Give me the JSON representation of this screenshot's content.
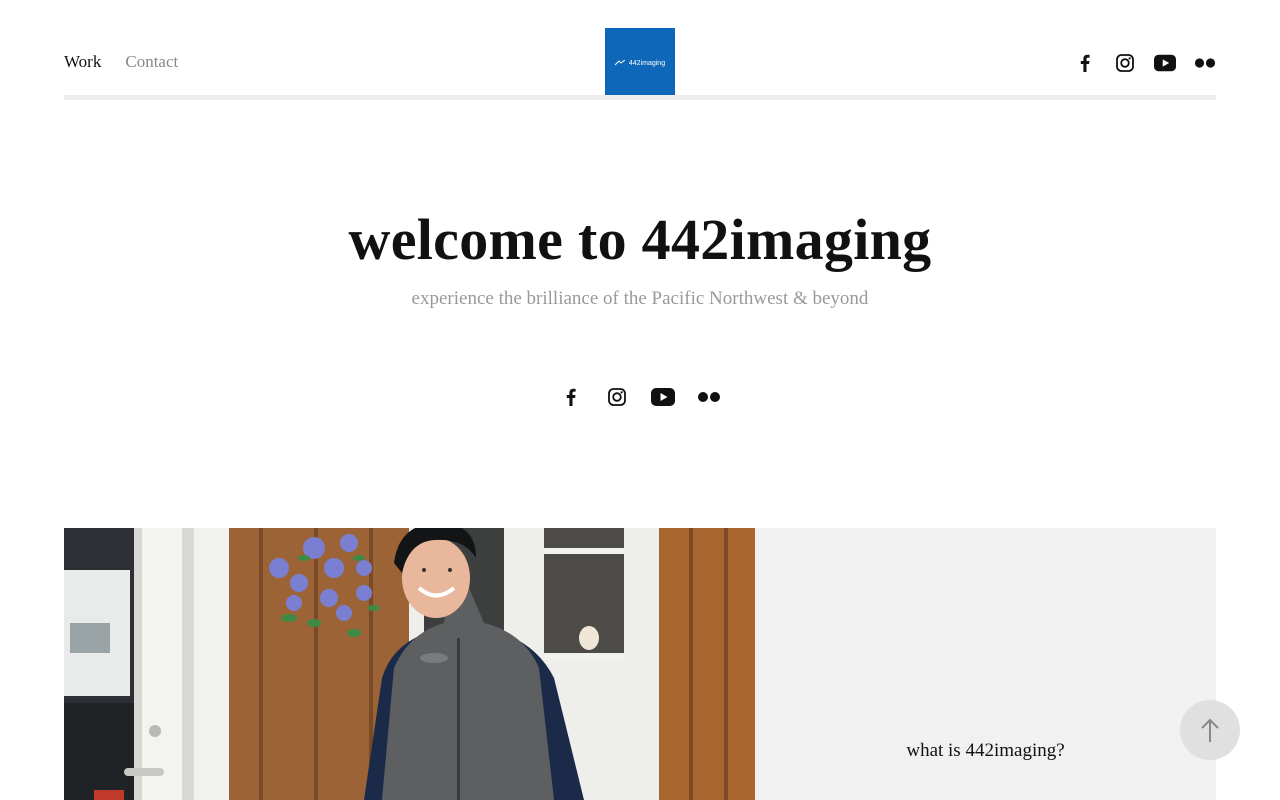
{
  "nav": {
    "items": [
      {
        "label": "Work",
        "active": true
      },
      {
        "label": "Contact",
        "active": false
      }
    ]
  },
  "logo": {
    "text": "442imaging",
    "background": "#0e67b8"
  },
  "social": {
    "icons": [
      "facebook-icon",
      "instagram-icon",
      "youtube-icon",
      "flickr-icon"
    ]
  },
  "hero": {
    "title": "welcome to 442imaging",
    "subtitle": "experience the brilliance of the Pacific Northwest & beyond"
  },
  "feature": {
    "question": "what is 442imaging?",
    "panel_color": "#f1f1f1"
  },
  "colors": {
    "text": "#111111",
    "muted": "#888888",
    "rule": "#eeeeee",
    "accent": "#0e67b8"
  }
}
